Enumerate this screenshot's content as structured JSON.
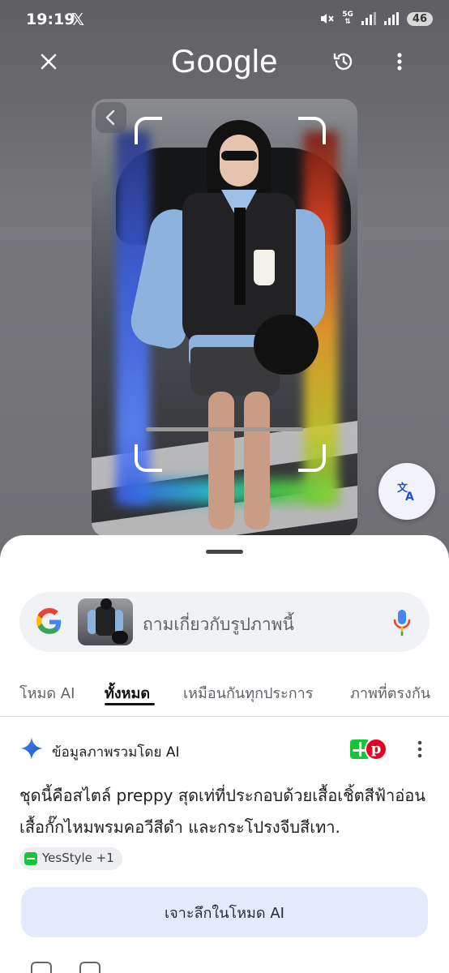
{
  "status_bar": {
    "time": "19:19",
    "app_glyph": "𝕏",
    "network": "5G",
    "battery": "46"
  },
  "header": {
    "logo_text": "Google",
    "icons": [
      "close-icon",
      "history-icon",
      "more-vert-icon"
    ]
  },
  "search": {
    "placeholder": "ถามเกี่ยวกับรูปภาพนี้"
  },
  "tabs": [
    {
      "label": "โหมด AI"
    },
    {
      "label": "ทั้งหมด",
      "active": true
    },
    {
      "label": "เหมือนกันทุกประการ"
    },
    {
      "label": "ภาพที่ตรงกัน"
    }
  ],
  "ai_overview": {
    "title": "ข้อมูลภาพรวมโดย AI",
    "text": "ชุดนี้คือสไตล์ preppy สุดเท่ที่ประกอบด้วยเสื้อเชิ้ตสีฟ้าอ่อน เสื้อกั๊กไหมพรมคอวีสีดำ และกระโปรงจีบสีเทา.",
    "source_chip": "YesStyle +1"
  },
  "deep_dive_button": "เจาะลึกในโหมด AI",
  "colors": {
    "google_blue": "#4285F4",
    "google_red": "#EA4335",
    "google_yellow": "#FBBC05",
    "google_green": "#34A853",
    "deep_dive_bg": "#e3ebfa"
  }
}
